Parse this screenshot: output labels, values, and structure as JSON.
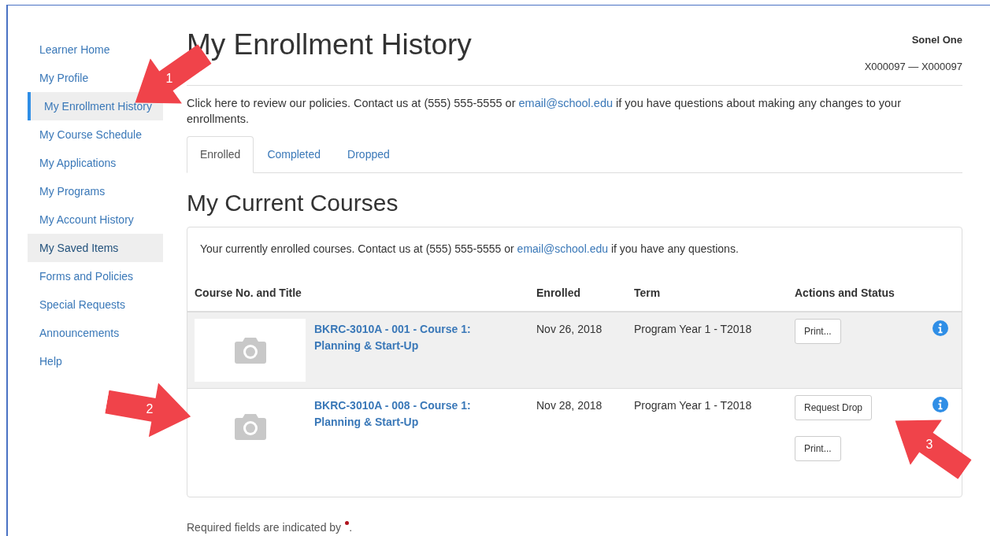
{
  "sidebar": {
    "items": [
      {
        "label": "Learner Home",
        "selected": false,
        "highlighted": false
      },
      {
        "label": "My Profile",
        "selected": false,
        "highlighted": false
      },
      {
        "label": "My Enrollment History",
        "selected": true,
        "highlighted": false
      },
      {
        "label": "My Course Schedule",
        "selected": false,
        "highlighted": false
      },
      {
        "label": "My Applications",
        "selected": false,
        "highlighted": false
      },
      {
        "label": "My Programs",
        "selected": false,
        "highlighted": false
      },
      {
        "label": "My Account History",
        "selected": false,
        "highlighted": false
      },
      {
        "label": "My Saved Items",
        "selected": false,
        "highlighted": true
      },
      {
        "label": "Forms and Policies",
        "selected": false,
        "highlighted": false
      },
      {
        "label": "Special Requests",
        "selected": false,
        "highlighted": false
      },
      {
        "label": "Announcements",
        "selected": false,
        "highlighted": false
      },
      {
        "label": "Help",
        "selected": false,
        "highlighted": false
      }
    ]
  },
  "page_title": "My Enrollment History",
  "user": {
    "name": "Sonel One",
    "id": "X000097 — X000097"
  },
  "notice": {
    "before": "Click here to review our policies. Contact us at (555) 555-5555 or",
    "link": "email@school.edu",
    "after": "if you have questions about making any changes to your enrollments."
  },
  "tabs": [
    {
      "label": "Enrolled",
      "selected": true
    },
    {
      "label": "Completed",
      "selected": false
    },
    {
      "label": "Dropped",
      "selected": false
    }
  ],
  "section_title": "My Current Courses",
  "panel_intro": {
    "before": "Your currently enrolled courses. Contact us at (555) 555-5555 or",
    "link": "email@school.edu",
    "after": "if you have any questions."
  },
  "table": {
    "columns": [
      "Course No. and Title",
      "Enrolled",
      "Term",
      "Actions and Status"
    ],
    "rows": [
      {
        "title": "BKRC-3010A - 001 - Course 1: Planning & Start-Up",
        "enrolled": "Nov 26, 2018",
        "term": "Program Year 1 - T2018",
        "actions": [
          "Print..."
        ],
        "highlighted": true
      },
      {
        "title": "BKRC-3010A - 008 - Course 1: Planning & Start-Up",
        "enrolled": "Nov 28, 2018",
        "term": "Program Year 1 - T2018",
        "actions": [
          "Request Drop",
          "Print..."
        ],
        "highlighted": false
      }
    ]
  },
  "footer_note": "Required fields are indicated by",
  "footer_end": ".",
  "callouts": [
    {
      "label": "1"
    },
    {
      "label": "2"
    },
    {
      "label": "3"
    }
  ]
}
